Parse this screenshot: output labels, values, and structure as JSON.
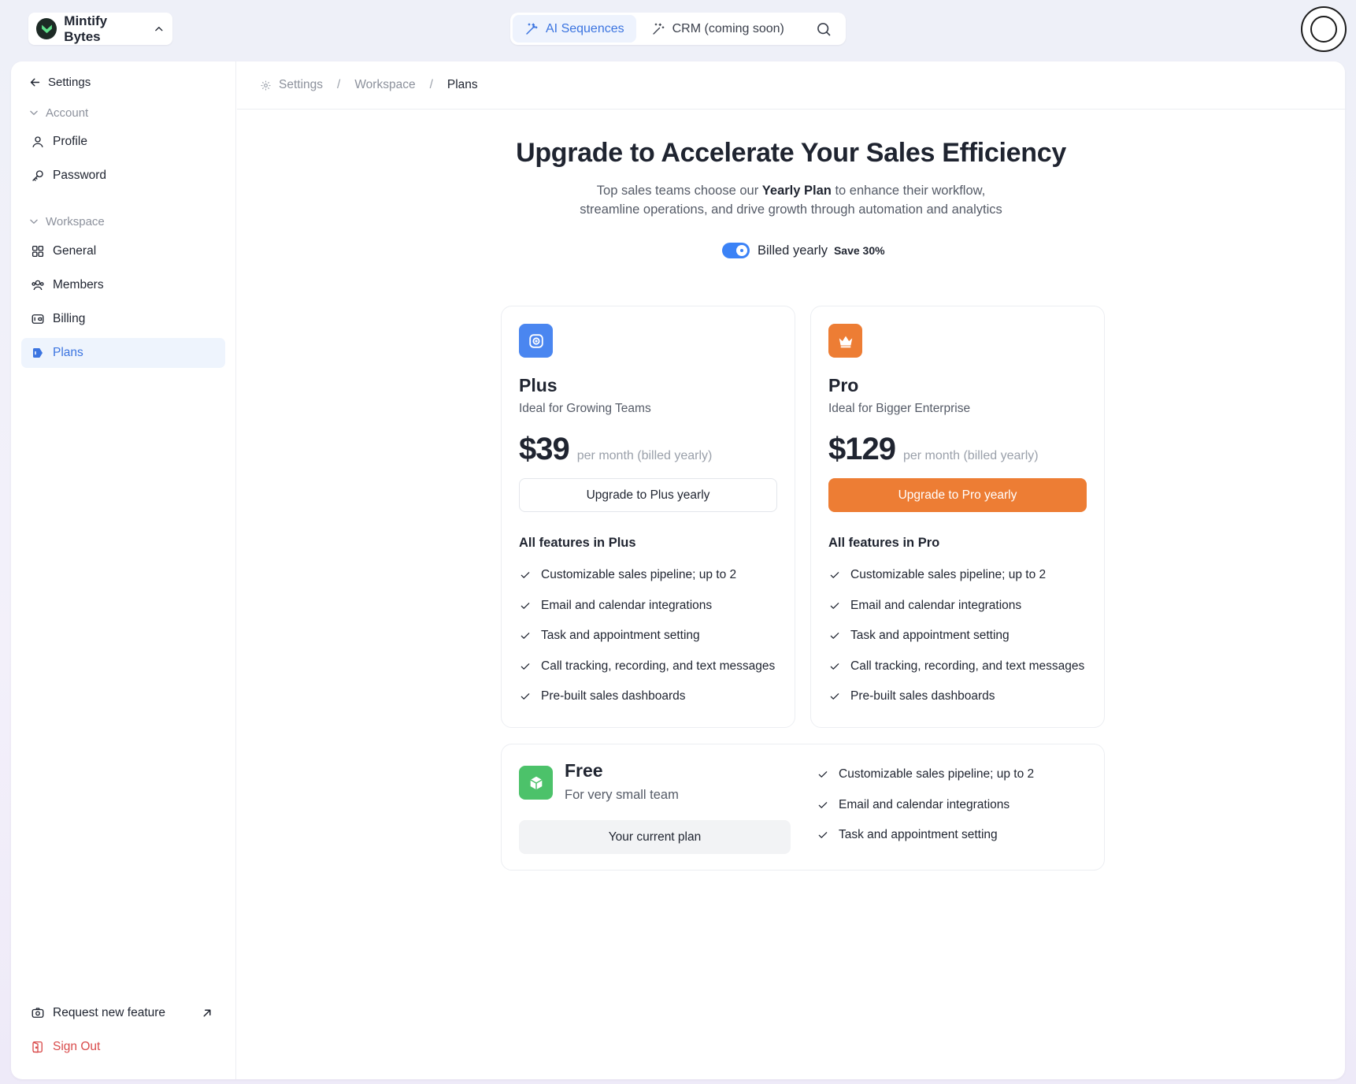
{
  "workspace": {
    "name": "Mintify Bytes"
  },
  "top_nav": {
    "tabs": [
      {
        "label": "AI Sequences",
        "active": true
      },
      {
        "label": "CRM (coming soon)",
        "active": false
      }
    ]
  },
  "sidebar": {
    "back_label": "Settings",
    "account_group": "Account",
    "account_items": [
      "Profile",
      "Password"
    ],
    "workspace_group": "Workspace",
    "workspace_items": [
      "General",
      "Members",
      "Billing",
      "Plans"
    ],
    "active_item": "Plans",
    "request_feature": "Request new feature",
    "sign_out": "Sign Out"
  },
  "breadcrumb": [
    "Settings",
    "Workspace",
    "Plans"
  ],
  "hero": {
    "title": "Upgrade to Accelerate Your Sales Efficiency",
    "sub_pre": "Top sales teams choose our ",
    "sub_bold": "Yearly Plan",
    "sub_post": " to enhance their workflow,",
    "sub_line2": "streamline operations, and drive growth through automation and analytics"
  },
  "billing": {
    "label": "Billed yearly",
    "badge": "Save 30%",
    "yearly": true
  },
  "plans": {
    "plus": {
      "name": "Plus",
      "tagline": "Ideal for Growing Teams",
      "price": "$39",
      "period": "per month (billed yearly)",
      "button": "Upgrade to Plus yearly",
      "features_title": "All features in Plus",
      "features": [
        "Customizable sales pipeline; up to 2",
        "Email and calendar integrations",
        "Task and appointment setting",
        "Call tracking, recording, and text messages",
        "Pre-built sales dashboards"
      ]
    },
    "pro": {
      "name": "Pro",
      "tagline": "Ideal for Bigger Enterprise",
      "price": "$129",
      "period": "per month (billed yearly)",
      "button": "Upgrade to Pro yearly",
      "features_title": "All features in Pro",
      "features": [
        "Customizable sales pipeline; up to 2",
        "Email and calendar integrations",
        "Task and appointment setting",
        "Call tracking, recording, and text messages",
        "Pre-built sales dashboards"
      ]
    },
    "free": {
      "name": "Free",
      "tagline": "For very small team",
      "button": "Your current plan",
      "features": [
        "Customizable sales pipeline; up to 2",
        "Email and calendar integrations",
        "Task and appointment setting"
      ]
    }
  },
  "colors": {
    "accent_blue": "#3b74e0",
    "pro_orange": "#ed7d34",
    "free_green": "#4cc26a",
    "sign_out_red": "#d94b4b"
  }
}
